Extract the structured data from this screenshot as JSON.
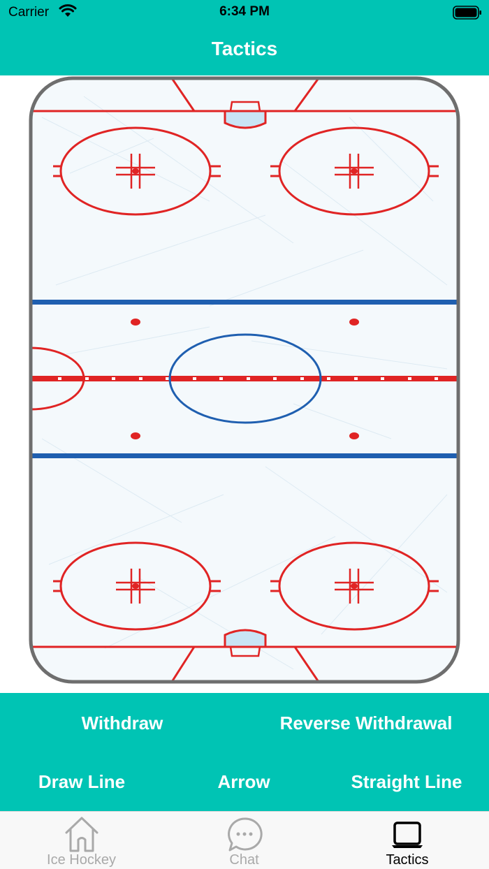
{
  "status_bar": {
    "carrier": "Carrier",
    "time": "6:34 PM"
  },
  "nav": {
    "title": "Tactics"
  },
  "controls": {
    "withdraw": "Withdraw",
    "reverse_withdrawal": "Reverse Withdrawal",
    "draw_line": "Draw Line",
    "arrow": "Arrow",
    "straight_line": "Straight Line"
  },
  "tab_bar": {
    "tabs": [
      {
        "label": "Ice Hockey",
        "icon": "home-icon",
        "active": false
      },
      {
        "label": "Chat",
        "icon": "chat-bubble-icon",
        "active": false
      },
      {
        "label": "Tactics",
        "icon": "tactics-board-icon",
        "active": true
      }
    ]
  },
  "colors": {
    "accent": "#00c4b4",
    "rink_red": "#e02424",
    "rink_blue": "#1f5fb0",
    "ice": "#f4f9fc",
    "boards": "#6e6e6e",
    "tab_inactive": "#a9a9a9"
  }
}
